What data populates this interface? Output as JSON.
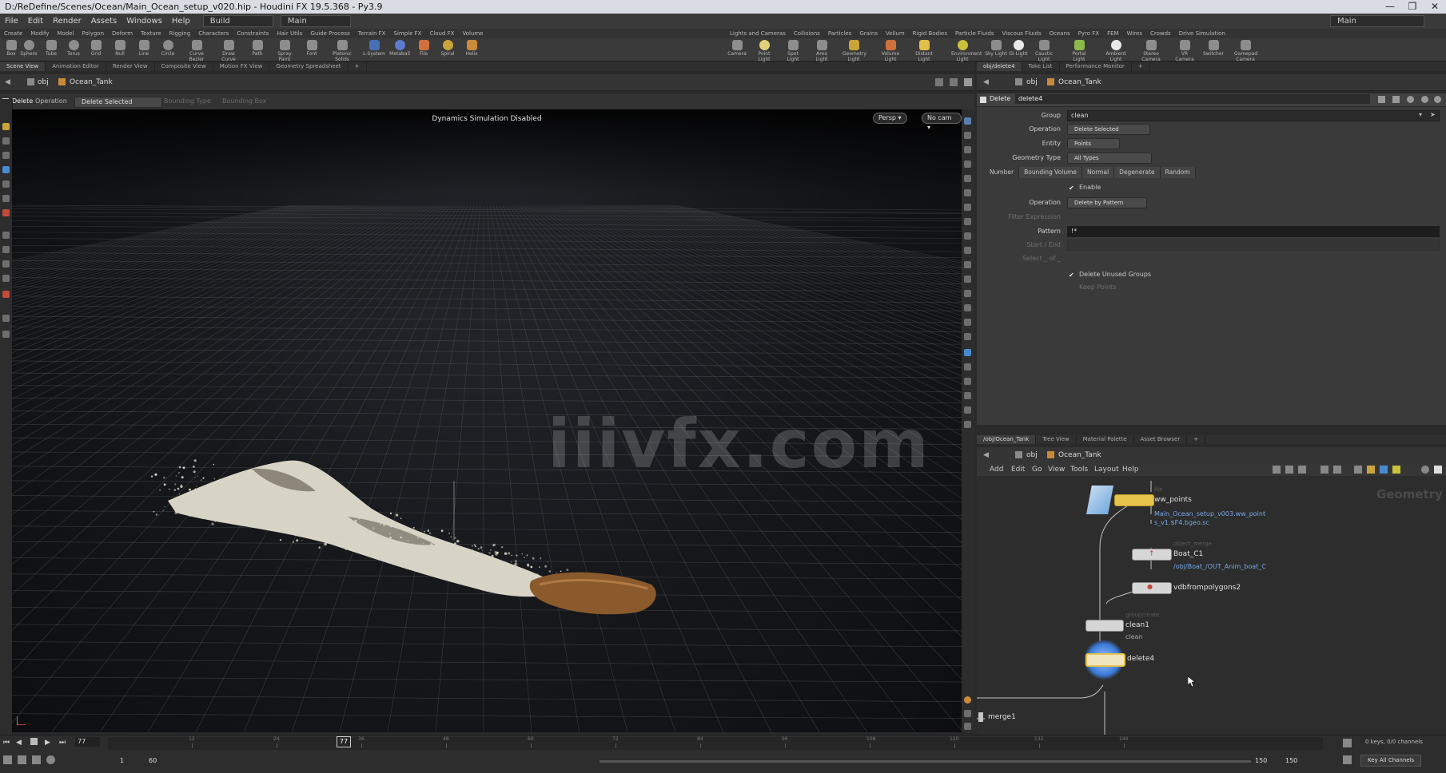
{
  "window": {
    "title": "D:/ReDefine/Scenes/Ocean/Main_Ocean_setup_v020.hip - Houdini FX 19.5.368 - Py3.9"
  },
  "menubar": {
    "items": [
      "File",
      "Edit",
      "Render",
      "Assets",
      "Windows",
      "Help"
    ],
    "desktop": "Build",
    "context": "Main",
    "right_desktop": "Main"
  },
  "shelf": {
    "left_tabs": [
      "Create",
      "Modify",
      "Model",
      "Polygon",
      "Deform",
      "Texture",
      "Rigging",
      "Characters",
      "Constraints",
      "Hair Utils",
      "Guide Process",
      "Terrain FX",
      "Simple FX",
      "Cloud FX",
      "Volume"
    ],
    "right_tabs": [
      "Lights and Cameras",
      "Collisions",
      "Particles",
      "Grains",
      "Vellum",
      "Rigid Bodies",
      "Particle Fluids",
      "Viscous Fluids",
      "Oceans",
      "Pyro FX",
      "FEM",
      "Wires",
      "Crowds",
      "Drive Simulation"
    ],
    "left_tools": [
      "Box",
      "Sphere",
      "Tube",
      "Torus",
      "Grid",
      "Null",
      "Line",
      "Circle",
      "Curve Bezier",
      "Draw Curve",
      "Path",
      "Spray Paint",
      "Font",
      "Platonic Solids",
      "L-System",
      "Metaball",
      "File",
      "Spiral",
      "Helix"
    ],
    "right_tools": [
      "Camera",
      "Point Light",
      "Spot Light",
      "Area Light",
      "Geometry Light",
      "Volume Light",
      "Distant Light",
      "Environment Light",
      "Sky Light",
      "GI Light",
      "Caustic Light",
      "Portal Light",
      "Ambient Light",
      "Stereo Camera",
      "VR Camera",
      "Switcher",
      "Gamepad Camera"
    ]
  },
  "left_pane": {
    "tabs": [
      "Scene View",
      "Animation Editor",
      "Render View",
      "Composite View",
      "Motion FX View",
      "Geometry Spreadsheet"
    ],
    "path": [
      "obj",
      "Ocean_Tank"
    ],
    "op_toolbar": {
      "node_type": "Delete",
      "operation_label": "Operation",
      "operation_value": "Delete Selected",
      "bounding_type": "Bounding Type",
      "bounding_box": "Bounding Box"
    },
    "viewport": {
      "status_message": "Dynamics Simulation Disabled",
      "camera_menu": "Persp",
      "cam_menu": "No cam",
      "watermark": "iiivfx.com"
    }
  },
  "right_top": {
    "tabs": [
      "obj/delete4",
      "Take List",
      "Performance Monitor"
    ],
    "path": [
      "obj",
      "Ocean_Tank"
    ],
    "node_type": "Delete",
    "node_name": "delete4",
    "params": {
      "group_label": "Group",
      "group_value": "clean",
      "operation_label": "Operation",
      "operation_value": "Delete Selected",
      "entity_label": "Entity",
      "entity_value": "Points",
      "geotype_label": "Geometry Type",
      "geotype_value": "All Types",
      "subtabs": [
        "Number",
        "Bounding Volume",
        "Normal",
        "Degenerate",
        "Random"
      ],
      "enable_label": "Enable",
      "num_operation_label": "Operation",
      "num_operation_value": "Delete by Pattern",
      "filter_label": "Filter Expression",
      "pattern_label": "Pattern",
      "pattern_value": "!*",
      "startend_label": "Start / End",
      "selectof_label": "Select _ of _",
      "delete_unused_label": "Delete Unused Groups",
      "keep_points_label": "Keep Points"
    }
  },
  "right_bottom": {
    "tabs": [
      "/obj/Ocean_Tank",
      "Tree View",
      "Material Palette",
      "Asset Browser"
    ],
    "path": [
      "obj",
      "Ocean_Tank"
    ],
    "menu": [
      "Add",
      "Edit",
      "Go",
      "View",
      "Tools",
      "Layout",
      "Help"
    ],
    "context_watermark": "Geometry",
    "nodes": {
      "wwpoints": {
        "name": "ww_points",
        "sub1": "Main_Ocean_setup_v003.ww_point",
        "sub2": "s_v1.$F4.bgeo.sc",
        "type": "file"
      },
      "boat": {
        "name": "Boat_C1",
        "sub": "/obj/Boat_/OUT_Anim_boat_C",
        "type": "object_merge"
      },
      "vdb": {
        "name": "vdbfrompolygons2"
      },
      "clean": {
        "name": "clean1",
        "sub": "clean",
        "type": "groupcreate"
      },
      "delete": {
        "name": "delete4"
      },
      "merge": {
        "name": "merge1"
      }
    }
  },
  "timeline": {
    "current_frame": "77",
    "start_frame": "1",
    "end_frame": "60",
    "range_end_a": "150",
    "range_end_b": "150",
    "ticks": [
      "12",
      "24",
      "36",
      "48",
      "60",
      "72",
      "84",
      "96",
      "108",
      "120",
      "132",
      "144"
    ],
    "keys_info": "0 keys, 0/0 channels",
    "key_all": "Key All Channels"
  }
}
